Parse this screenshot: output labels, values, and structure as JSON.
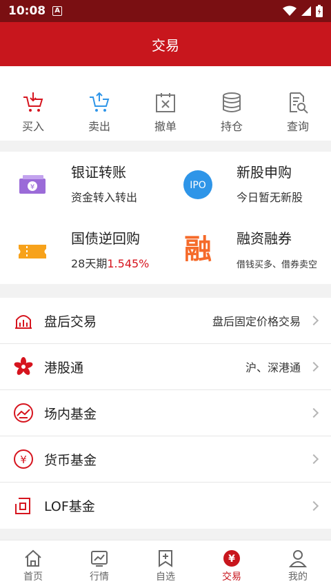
{
  "status": {
    "time": "10:08",
    "a_label": "A"
  },
  "header": {
    "title": "交易"
  },
  "quick_actions": [
    {
      "label": "买入",
      "icon": "cart-in-icon"
    },
    {
      "label": "卖出",
      "icon": "cart-out-icon"
    },
    {
      "label": "撤单",
      "icon": "calendar-cancel-icon"
    },
    {
      "label": "持仓",
      "icon": "database-icon"
    },
    {
      "label": "查询",
      "icon": "document-search-icon"
    }
  ],
  "services": [
    {
      "title": "银证转账",
      "subtitle": "资金转入转出",
      "icon": "bank-transfer-icon"
    },
    {
      "title": "新股申购",
      "subtitle": "今日暂无新股",
      "icon": "ipo-icon",
      "icon_text": "IPO"
    },
    {
      "title": "国债逆回购",
      "subtitle_prefix": "28天期",
      "rate": "1.545%",
      "icon": "ticket-icon"
    },
    {
      "title": "融资融券",
      "subtitle": "借钱买多、借券卖空",
      "icon": "margin-icon",
      "icon_text": "融"
    }
  ],
  "menu": [
    {
      "title": "盘后交易",
      "right": "盘后固定价格交易",
      "icon": "after-hours-chart-icon"
    },
    {
      "title": "港股通",
      "right": "沪、深港通",
      "icon": "bauhinia-icon"
    },
    {
      "title": "场内基金",
      "right": "",
      "icon": "fund-trend-icon"
    },
    {
      "title": "货币基金",
      "right": "",
      "icon": "yuan-coin-icon"
    },
    {
      "title": "LOF基金",
      "right": "",
      "icon": "lof-fund-icon"
    }
  ],
  "tabs": [
    {
      "label": "首页",
      "icon": "home-icon",
      "active": false
    },
    {
      "label": "行情",
      "icon": "market-chart-icon",
      "active": false
    },
    {
      "label": "自选",
      "icon": "bookmark-plus-icon",
      "active": false
    },
    {
      "label": "交易",
      "icon": "yuan-circle-icon",
      "active": true,
      "icon_text": "¥"
    },
    {
      "label": "我的",
      "icon": "user-icon",
      "active": false
    }
  ],
  "colors": {
    "primary": "#c8161d",
    "status_bar": "#7a0f12",
    "accent_blue": "#2e95e8",
    "accent_orange": "#f56a2a",
    "accent_purple": "#9b6bd8",
    "accent_yellow": "#f7a21b"
  }
}
